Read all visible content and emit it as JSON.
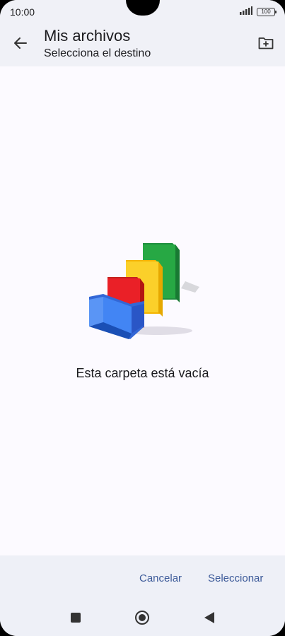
{
  "status_bar": {
    "time": "10:00",
    "battery": "100"
  },
  "header": {
    "title": "Mis archivos",
    "subtitle": "Selecciona el destino",
    "back_icon": "arrow-back-icon",
    "new_folder_icon": "create-new-folder-icon"
  },
  "main": {
    "empty_message": "Esta carpeta está vacía",
    "illustration": "empty-folders-illustration"
  },
  "actions": {
    "cancel_label": "Cancelar",
    "select_label": "Seleccionar"
  },
  "nav": {
    "recents": "recents-icon",
    "home": "home-icon",
    "back": "back-triangle-icon"
  },
  "colors": {
    "accent": "#3c5a99",
    "header_bg": "#f0f1f7",
    "page_bg": "#fcfaff",
    "blue": "#4285f4",
    "red": "#ea2027",
    "yellow": "#fbd02a",
    "green": "#27a844"
  }
}
